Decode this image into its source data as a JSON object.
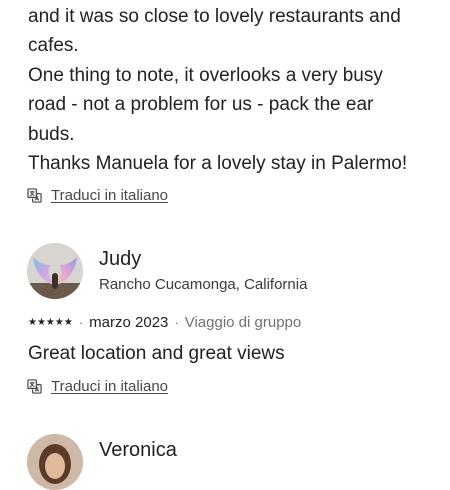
{
  "review1": {
    "lines": [
      "and it was so close to lovely restaurants and",
      "cafes.",
      "One thing to note, it overlooks a very busy",
      "road - not a problem for us - pack the ear",
      "buds.",
      "Thanks Manuela for a lovely stay in Palermo!"
    ],
    "translate_label": "Traduci in italiano"
  },
  "review2": {
    "name": "Judy",
    "location": "Rancho Cucamonga, California",
    "rating": 5,
    "stars": "★★★★★",
    "date": "marzo 2023",
    "trip_type": "Viaggio di gruppo",
    "text": "Great location and great views",
    "translate_label": "Traduci in italiano"
  },
  "review3": {
    "name": "Veronica"
  },
  "icons": {
    "translate": "translate-icon",
    "star": "star-icon"
  }
}
